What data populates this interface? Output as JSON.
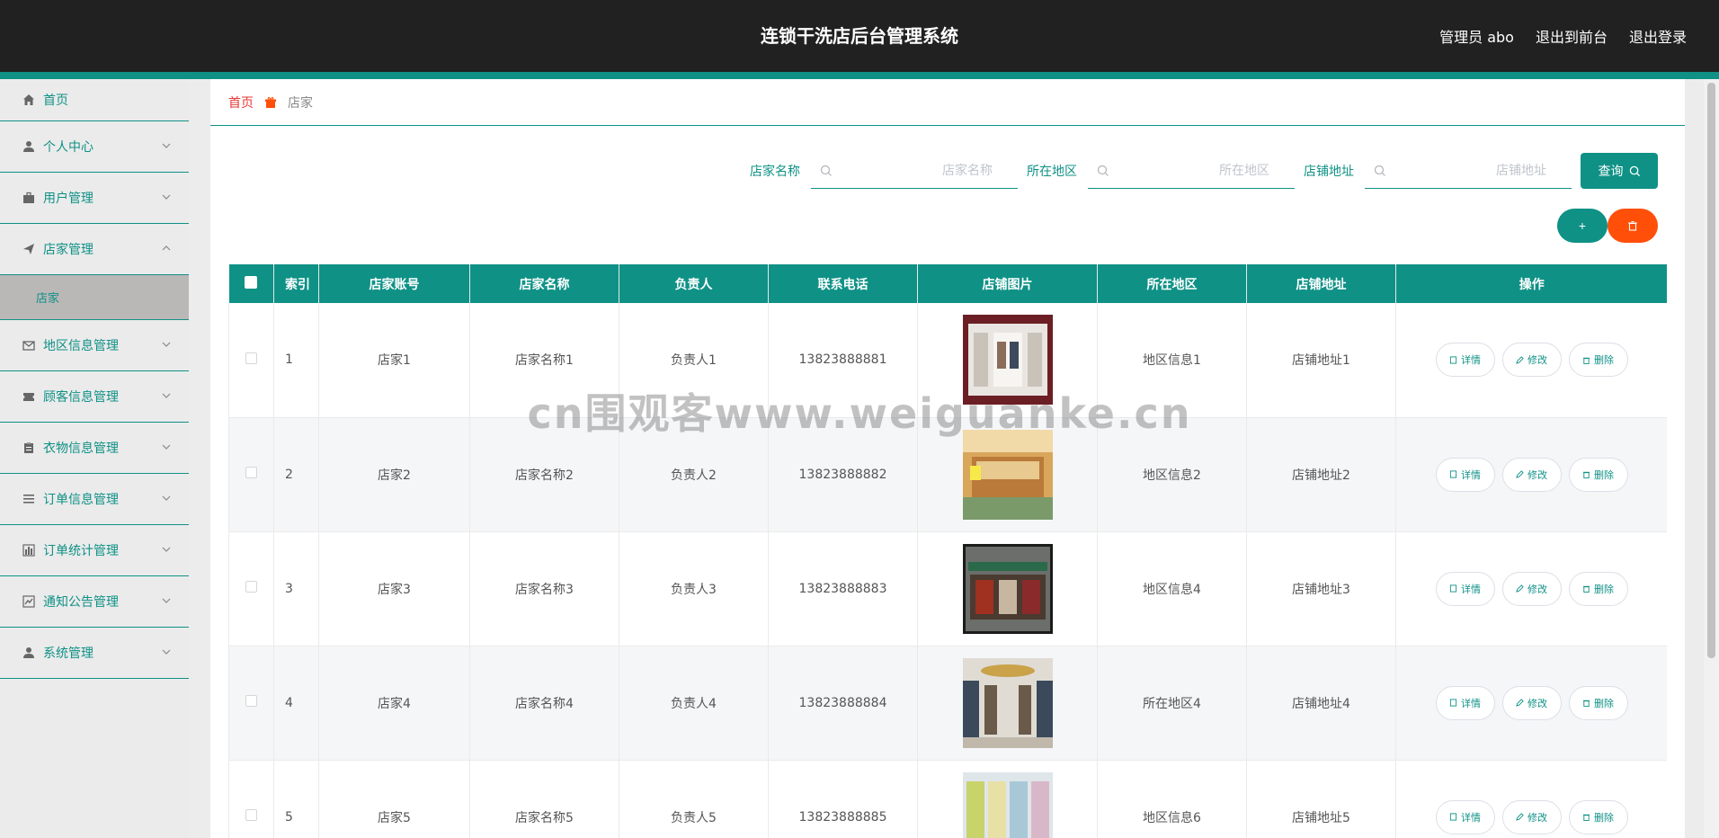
{
  "header": {
    "title": "连锁干洗店后台管理系统",
    "admin_label": "管理员 abo",
    "to_front_label": "退出到前台",
    "logout_label": "退出登录"
  },
  "sidebar": {
    "items": [
      {
        "label": "首页",
        "icon": "home-icon"
      },
      {
        "label": "个人中心",
        "icon": "user-icon"
      },
      {
        "label": "用户管理",
        "icon": "briefcase-icon"
      },
      {
        "label": "店家管理",
        "icon": "send-icon",
        "expanded": true
      },
      {
        "label": "地区信息管理",
        "icon": "mail-icon"
      },
      {
        "label": "顾客信息管理",
        "icon": "ticket-icon"
      },
      {
        "label": "衣物信息管理",
        "icon": "clipboard-icon"
      },
      {
        "label": "订单信息管理",
        "icon": "list-icon"
      },
      {
        "label": "订单统计管理",
        "icon": "bar-chart-icon"
      },
      {
        "label": "通知公告管理",
        "icon": "trend-icon"
      },
      {
        "label": "系统管理",
        "icon": "user-icon"
      }
    ],
    "sub_item": "店家"
  },
  "breadcrumb": {
    "home": "首页",
    "current": "店家"
  },
  "search": {
    "name_label": "店家名称",
    "name_placeholder": "店家名称",
    "region_label": "所在地区",
    "region_placeholder": "所在地区",
    "address_label": "店铺地址",
    "address_placeholder": "店铺地址",
    "query_label": "查询"
  },
  "actions": {
    "add_label": "+",
    "delete_icon": "trash-icon"
  },
  "table": {
    "headers": [
      "索引",
      "店家账号",
      "店家名称",
      "负责人",
      "联系电话",
      "店铺图片",
      "所在地区",
      "店铺地址",
      "操作"
    ],
    "rows": [
      {
        "index": "1",
        "account": "店家1",
        "name": "店家名称1",
        "manager": "负责人1",
        "phone": "13823888881",
        "region": "地区信息1",
        "address": "店铺地址1"
      },
      {
        "index": "2",
        "account": "店家2",
        "name": "店家名称2",
        "manager": "负责人2",
        "phone": "13823888882",
        "region": "地区信息2",
        "address": "店铺地址2"
      },
      {
        "index": "3",
        "account": "店家3",
        "name": "店家名称3",
        "manager": "负责人3",
        "phone": "13823888883",
        "region": "地区信息4",
        "address": "店铺地址3"
      },
      {
        "index": "4",
        "account": "店家4",
        "name": "店家名称4",
        "manager": "负责人4",
        "phone": "13823888884",
        "region": "所在地区4",
        "address": "店铺地址4"
      },
      {
        "index": "5",
        "account": "店家5",
        "name": "店家名称5",
        "manager": "负责人5",
        "phone": "13823888885",
        "region": "地区信息6",
        "address": "店铺地址5"
      }
    ],
    "op_detail": "详情",
    "op_edit": "修改",
    "op_delete": "删除"
  },
  "watermark": "cn围观客www.weiguanke.cn",
  "colors": {
    "accent": "#0f9186",
    "topbar": "#212121",
    "danger": "#ff4f09",
    "breadcrumb_home": "#e53935"
  }
}
